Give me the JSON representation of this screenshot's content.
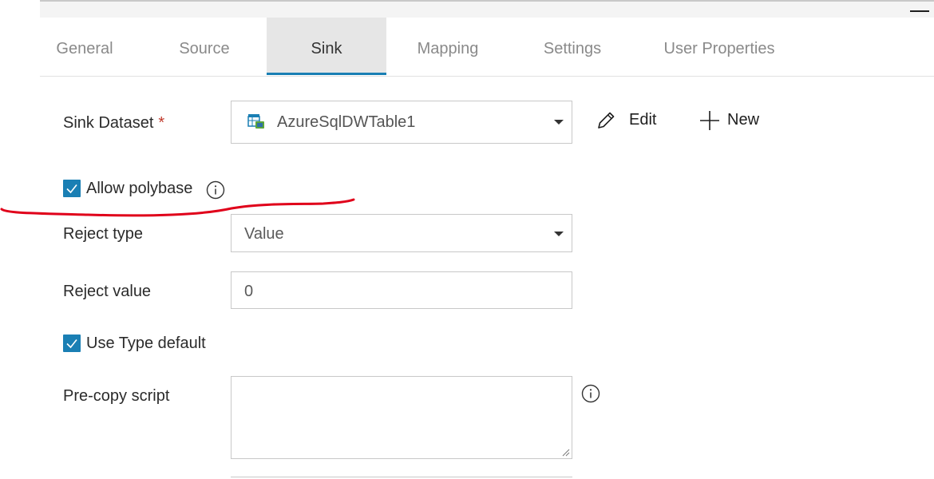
{
  "tabs": [
    {
      "label": "General"
    },
    {
      "label": "Source"
    },
    {
      "label": "Sink"
    },
    {
      "label": "Mapping"
    },
    {
      "label": "Settings"
    },
    {
      "label": "User Properties"
    }
  ],
  "active_tab": "Sink",
  "sink_dataset": {
    "label": "Sink Dataset",
    "required_marker": "*",
    "value": "AzureSqlDWTable1",
    "icon": "sql-table-icon"
  },
  "actions": {
    "edit_label": "Edit",
    "new_label": "New"
  },
  "allow_polybase": {
    "label": "Allow polybase",
    "checked": true
  },
  "reject_type": {
    "label": "Reject type",
    "value": "Value"
  },
  "reject_value": {
    "label": "Reject value",
    "value": "0"
  },
  "use_type_default": {
    "label": "Use Type default",
    "checked": true
  },
  "pre_copy_script": {
    "label": "Pre-copy script",
    "value": ""
  },
  "colors": {
    "accent": "#1a7fb4",
    "required": "#c0392b",
    "annotation": "#e0001a"
  }
}
